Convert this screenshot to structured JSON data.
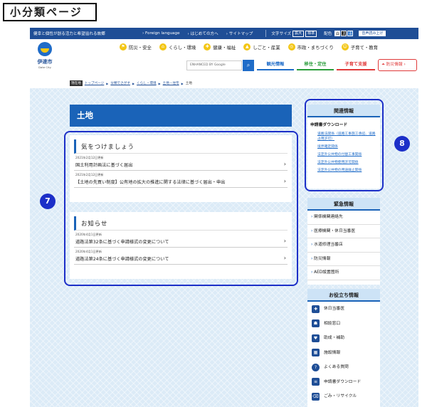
{
  "label": "小分類ページ",
  "topbar": {
    "slogan": "健幸と個性が創る活力と希望溢れる故郷",
    "links": [
      "Foreign language",
      "はじめての方へ",
      "サイトマップ"
    ],
    "text_size_label": "文字サイズ",
    "text_size_buttons": [
      "拡大",
      "標準"
    ],
    "color_label": "配色",
    "color_buttons": [
      "白",
      "黒",
      "青"
    ],
    "voice_label": "音声読み上げ"
  },
  "header": {
    "logo_name": "伊達市",
    "logo_en": "Date City",
    "categories": [
      "防災・安全",
      "くらし・環境",
      "健康・福祉",
      "しごと・産業",
      "市政・まちづくり",
      "子育て・教育"
    ],
    "search_placeholder": "ENHANCED BY Google",
    "nav": [
      "観光情報",
      "移住・定住",
      "子育て支援"
    ],
    "bosai_label": "防災情報"
  },
  "breadcrumb": {
    "here_label": "現在地",
    "items": [
      "トップページ",
      "分類でさがす",
      "くらし・環境",
      "土地・住宅"
    ],
    "current": "土地"
  },
  "main": {
    "title": "土地",
    "sections": [
      {
        "heading": "気をつけましょう",
        "items": [
          {
            "date": "2021年2月12日更新",
            "title": "国土利用計画法に基づく届出"
          },
          {
            "date": "2021年2月12日更新",
            "title": "【土地の先買い制度】公有地の拡大の推進に関する法律に基づく届出・申出"
          }
        ]
      },
      {
        "heading": "お知らせ",
        "items": [
          {
            "date": "2020年4月1日更新",
            "title": "道路法第32条に基づく申請様式の変更について"
          },
          {
            "date": "2020年4月1日更新",
            "title": "道路法第24条に基づく申請様式の変更について"
          }
        ]
      }
    ]
  },
  "related": {
    "heading": "関連情報",
    "sub": "申請書ダウンロード",
    "links": [
      "道路法関係（道路工事施工承認、道路占用許可）",
      "境界確定関係",
      "法定外公共物の付替工事関係",
      "法定外公共物使用許可関係",
      "法定外公共物の用途廃止関係"
    ]
  },
  "emergency": {
    "heading": "緊急情報",
    "items": [
      "関係機関連絡先",
      "医療機関・休日当番医",
      "水道修理当番店",
      "防災情報",
      "AED設置箇所"
    ]
  },
  "useful": {
    "heading": "お役立ち情報",
    "items": [
      "休日当番医",
      "相談窓口",
      "助成・補助",
      "施設情報",
      "よくある質問",
      "申請書ダウンロード",
      "ごみ・リサイクル"
    ]
  },
  "markers": [
    "7",
    "8"
  ]
}
